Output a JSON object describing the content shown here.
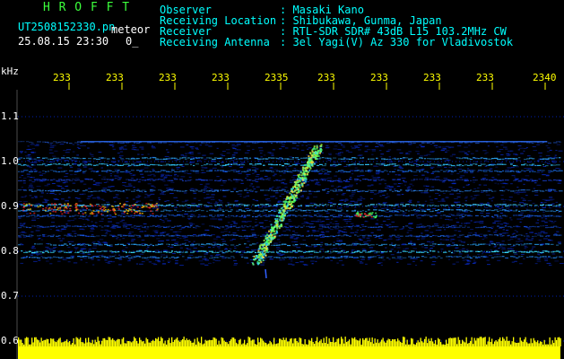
{
  "header": {
    "brand": "H R O F F T",
    "filename": "UT2508152330.pn",
    "mode": "meteor",
    "datetime": "25.08.15 23:30",
    "status": "0_",
    "info_labels": [
      "Observer",
      "Receiving Location",
      "Receiver",
      "Receiving Antenna"
    ],
    "info_values": [
      ": Masaki Kano",
      ": Shibukawa, Gunma, Japan",
      ": RTL-SDR SDR# 43dB L15 103.2MHz CW",
      ": 3el Yagi(V) Az 330 for Vladivostok"
    ]
  },
  "axis": {
    "unit": "kHz",
    "y_ticks": [
      "1.1",
      "1.0",
      "0.9",
      "0.8",
      "0.7",
      "0.6"
    ],
    "x_ticks": [
      "233",
      "233",
      "233",
      "233",
      "2335",
      "233",
      "233",
      "233",
      "233",
      "2340"
    ]
  },
  "colors": {
    "background": "#000000",
    "header_text": "#00ffff",
    "ticks": "#ffff00",
    "waterfall_low": "#000a7a",
    "waterfall_high": "#ff2020",
    "audio_level": "#ffff00"
  }
}
